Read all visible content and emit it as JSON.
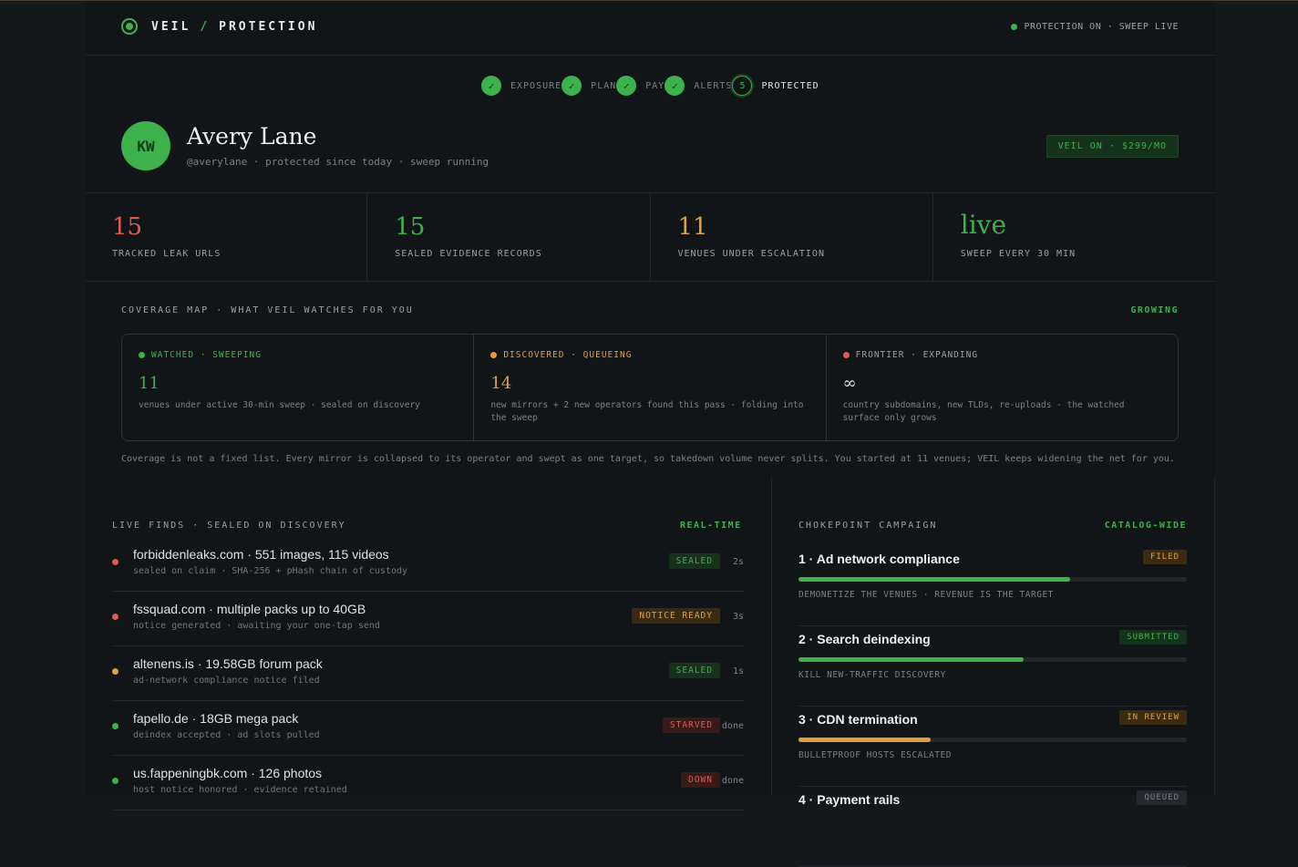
{
  "header": {
    "brand_left": "VEIL",
    "brand_sep": "/",
    "brand_right": "PROTECTION",
    "status": "PROTECTION ON · SWEEP LIVE"
  },
  "steps": [
    {
      "label": "EXPOSURE",
      "state": "done"
    },
    {
      "label": "PLAN",
      "state": "done"
    },
    {
      "label": "PAY",
      "state": "done"
    },
    {
      "label": "ALERTS",
      "state": "done"
    },
    {
      "label": "PROTECTED",
      "state": "active",
      "number": "5"
    }
  ],
  "step_check": "✓",
  "profile": {
    "initials": "KW",
    "name": "Avery Lane",
    "subtitle": "@averylane · protected since today · sweep running",
    "plan_badge": "VEIL ON · $299/MO"
  },
  "stats": [
    {
      "value": "15",
      "label": "TRACKED LEAK URLS",
      "color": "#e05a4e"
    },
    {
      "value": "15",
      "label": "SEALED EVIDENCE RECORDS",
      "color": "#3db24c"
    },
    {
      "value": "11",
      "label": "VENUES UNDER ESCALATION",
      "color": "#e0a040"
    },
    {
      "value": "live",
      "label": "SWEEP EVERY 30 MIN",
      "color": "#3db24c"
    }
  ],
  "coverage": {
    "title": "COVERAGE MAP · WHAT VEIL WATCHES FOR YOU",
    "tag": "GROWING",
    "columns": [
      {
        "header": "WATCHED · SWEEPING",
        "value": "11",
        "desc": "venues under active 30-min sweep · sealed on discovery",
        "color": "#3db24c"
      },
      {
        "header": "DISCOVERED · QUEUEING",
        "value": "14",
        "desc": "new mirrors + 2 new operators found this pass · folding into the sweep",
        "color": "#e0a040"
      },
      {
        "header": "FRONTIER · EXPANDING",
        "value": "∞",
        "desc": "country subdomains, new TLDs, re-uploads · the watched surface only grows",
        "color": "#e05a4e"
      }
    ],
    "note": "Coverage is not a fixed list. Every mirror is collapsed to its operator and swept as one target, so takedown volume never splits. You started at 11 venues; VEIL keeps widening the net for you."
  },
  "finds": {
    "title": "LIVE FINDS · SEALED ON DISCOVERY",
    "tag": "REAL-TIME",
    "items": [
      {
        "title": "forbiddenleaks.com · 551 images, 115 videos",
        "sub": "sealed on claim · SHA-256 + pHash chain of custody",
        "badge": "SEALED",
        "badge_type": "sealed",
        "time": "2s",
        "dot": "#e05a4e"
      },
      {
        "title": "fssquad.com · multiple packs up to 40GB",
        "sub": "notice generated · awaiting your one-tap send",
        "badge": "NOTICE READY",
        "badge_type": "notice",
        "time": "3s",
        "dot": "#e05a4e"
      },
      {
        "title": "altenens.is · 19.58GB forum pack",
        "sub": "ad-network compliance notice filed",
        "badge": "SEALED",
        "badge_type": "sealed",
        "time": "1s",
        "dot": "#e0a040"
      },
      {
        "title": "fapello.de · 18GB mega pack",
        "sub": "deindex accepted · ad slots pulled",
        "badge": "STARVED",
        "badge_type": "red",
        "time": "done",
        "dot": "#3db24c"
      },
      {
        "title": "us.fappeningbk.com · 126 photos",
        "sub": "host notice honored · evidence retained",
        "badge": "DOWN",
        "badge_type": "red",
        "time": "done",
        "dot": "#3db24c"
      }
    ]
  },
  "campaign": {
    "title": "CHOKEPOINT CAMPAIGN",
    "tag": "CATALOG-WIDE",
    "items": [
      {
        "title": "1 · Ad network compliance",
        "badge": "FILED",
        "badge_type": "notice",
        "progress": 0.7,
        "bar_color": "#3db24c",
        "sub": "DEMONETIZE THE VENUES · REVENUE IS THE TARGET"
      },
      {
        "title": "2 · Search deindexing",
        "badge": "SUBMITTED",
        "badge_type": "sealed",
        "progress": 0.58,
        "bar_color": "#3db24c",
        "sub": "KILL NEW-TRAFFIC DISCOVERY"
      },
      {
        "title": "3 · CDN termination",
        "badge": "IN REVIEW",
        "badge_type": "notice",
        "progress": 0.34,
        "bar_color": "#e0a040",
        "sub": "BULLETPROOF HOSTS ESCALATED"
      },
      {
        "title": "4 · Payment rails",
        "badge": "QUEUED",
        "badge_type": "grey",
        "progress": 0.0,
        "bar_color": "#3db24c",
        "sub": ""
      }
    ]
  }
}
